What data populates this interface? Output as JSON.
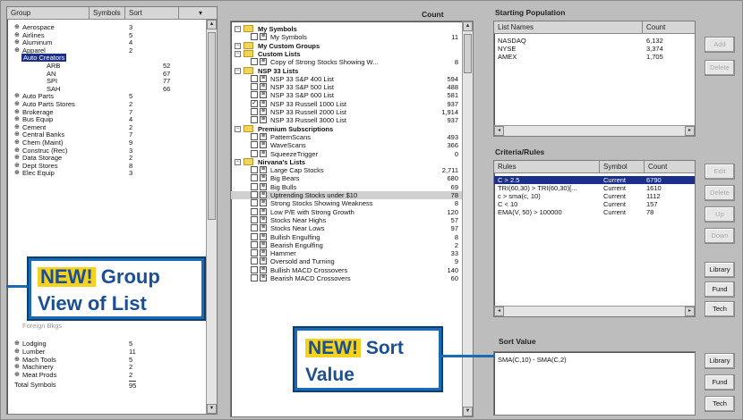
{
  "left_panel": {
    "headers": [
      "Group",
      "Symbols",
      "Sort"
    ],
    "items": [
      {
        "label": "Aerospace",
        "count": "3"
      },
      {
        "label": "Airlines",
        "count": "5"
      },
      {
        "label": "Aluminum",
        "count": "4"
      },
      {
        "label": "Apparel",
        "count": "2"
      },
      {
        "label": "Auto Creators",
        "count": ""
      }
    ],
    "sub_items": [
      {
        "label": "ARB",
        "sort": "52"
      },
      {
        "label": "AN",
        "sort": "67"
      },
      {
        "label": "SPI",
        "sort": "77"
      },
      {
        "label": "SAH",
        "sort": "66"
      }
    ],
    "items2": [
      {
        "label": "Auto Parts",
        "count": "5"
      },
      {
        "label": "Auto Parts Stores",
        "count": "2"
      },
      {
        "label": "Brokerage",
        "count": "7"
      },
      {
        "label": "Bus Equip",
        "count": "4"
      },
      {
        "label": "Cement",
        "count": "2"
      },
      {
        "label": "Central Banks",
        "count": "7"
      },
      {
        "label": "Chem (Maint)",
        "count": "9"
      },
      {
        "label": "Construc (Rec)",
        "count": "3"
      },
      {
        "label": "Data Storage",
        "count": "2"
      },
      {
        "label": "Dept Stores",
        "count": "8"
      },
      {
        "label": "Elec Equip",
        "count": "3"
      }
    ],
    "items3": [
      {
        "label": "Lodging",
        "count": "5"
      },
      {
        "label": "Lumber",
        "count": "11"
      },
      {
        "label": "Mach Tools",
        "count": "5"
      },
      {
        "label": "Machinery",
        "count": "2"
      },
      {
        "label": "Meat Prods",
        "count": "2"
      }
    ],
    "total_label": "Total Symbols",
    "total_value": "95",
    "partial_item": "Foreign Bkgs"
  },
  "callout_group": {
    "new": "NEW!",
    "line1": "Group",
    "line2": "View of List"
  },
  "middle_panel": {
    "count_header": "Count",
    "rows": [
      {
        "type": "folder",
        "label": "My Symbols",
        "count": ""
      },
      {
        "type": "item",
        "label": "My Symbols",
        "count": "11"
      },
      {
        "type": "folder",
        "label": "My Custom Groups",
        "count": ""
      },
      {
        "type": "folder",
        "label": "Custom Lists",
        "count": ""
      },
      {
        "type": "item",
        "label": "Copy of Strong Stocks Showing W...",
        "count": "8"
      },
      {
        "type": "folder",
        "label": "NSP 33 Lists",
        "count": ""
      },
      {
        "type": "item",
        "label": "NSP 33 S&P 400 List",
        "count": "594"
      },
      {
        "type": "item",
        "label": "NSP 33 S&P 500 List",
        "count": "488"
      },
      {
        "type": "item",
        "label": "NSP 33 S&P 600 List",
        "count": "581"
      },
      {
        "type": "item",
        "label": "NSP 33 Russell 1000 List",
        "count": "937",
        "checked": true
      },
      {
        "type": "item",
        "label": "NSP 33 Russell 2000 List",
        "count": "1,914"
      },
      {
        "type": "item",
        "label": "NSP 33 Russell 3000 List",
        "count": "937"
      },
      {
        "type": "folder",
        "label": "Premium Subscriptions",
        "count": ""
      },
      {
        "type": "item",
        "label": "PatternScans",
        "count": "493"
      },
      {
        "type": "item",
        "label": "WaveScans",
        "count": "366"
      },
      {
        "type": "item",
        "label": "SqueezeTrigger",
        "count": "0"
      },
      {
        "type": "folder",
        "label": "Nirvana's Lists",
        "count": ""
      },
      {
        "type": "item",
        "label": "Large Cap Stocks",
        "count": "2,711"
      },
      {
        "type": "item",
        "label": "Big Bears",
        "count": "680"
      },
      {
        "type": "item",
        "label": "Big Bulls",
        "count": "69"
      },
      {
        "type": "item",
        "label": "Uptrending Stocks under $10",
        "count": "78",
        "selected": true
      },
      {
        "type": "item",
        "label": "Strong Stocks Showing Weakness",
        "count": "8"
      },
      {
        "type": "item",
        "label": "Low P/E with Strong Growth",
        "count": "120"
      },
      {
        "type": "item",
        "label": "Stocks Near Highs",
        "count": "57"
      },
      {
        "type": "item",
        "label": "Stocks Near Lows",
        "count": "97"
      },
      {
        "type": "item",
        "label": "Bullish Engulfing",
        "count": "8"
      },
      {
        "type": "item",
        "label": "Bearish Engulfing",
        "count": "2"
      },
      {
        "type": "item",
        "label": "Hammer",
        "count": "33"
      },
      {
        "type": "item",
        "label": "Oversold and Turning",
        "count": "9"
      },
      {
        "type": "item",
        "label": "Bullish MACD Crossovers",
        "count": "140"
      },
      {
        "type": "item",
        "label": "Bearish MACD Crossovers",
        "count": "60"
      }
    ]
  },
  "callout_sort": {
    "new": "NEW!",
    "line1": "Sort",
    "line2": "Value"
  },
  "starting_population": {
    "title": "Starting Population",
    "headers": [
      "List Names",
      "Count"
    ],
    "rows": [
      {
        "name": "NASDAQ",
        "count": "6,132"
      },
      {
        "name": "NYSE",
        "count": "3,374"
      },
      {
        "name": "AMEX",
        "count": "1,705"
      }
    ],
    "buttons": [
      "Add",
      "Delete"
    ]
  },
  "criteria_rules": {
    "title": "Criteria/Rules",
    "headers": [
      "Rules",
      "Symbol",
      "Count"
    ],
    "rows": [
      {
        "rule": "C > 2.5",
        "symbol": "Current",
        "count": "6790"
      },
      {
        "rule": "TRI(60,30) > TRI(60,30)[...",
        "symbol": "Current",
        "count": "1610"
      },
      {
        "rule": "c > sma(c, 10)",
        "symbol": "Current",
        "count": "1112"
      },
      {
        "rule": "C < 10",
        "symbol": "Current",
        "count": "157"
      },
      {
        "rule": "EMA(V, 50) > 100000",
        "symbol": "Current",
        "count": "78"
      }
    ],
    "buttons_top": [
      "Edit",
      "Delete",
      "Up",
      "Down"
    ],
    "buttons_bottom": [
      "Library",
      "Fund",
      "Tech"
    ]
  },
  "sort_value": {
    "title": "Sort Value",
    "value": "SMA(C,10) - SMA(C,2)",
    "buttons": [
      "Library",
      "Fund",
      "Tech"
    ]
  },
  "colors": {
    "callout_blue": "#1a6ab4",
    "new_yellow": "#f4d21f",
    "selection": "#1c2f8a",
    "folder": "#f2d45a"
  }
}
